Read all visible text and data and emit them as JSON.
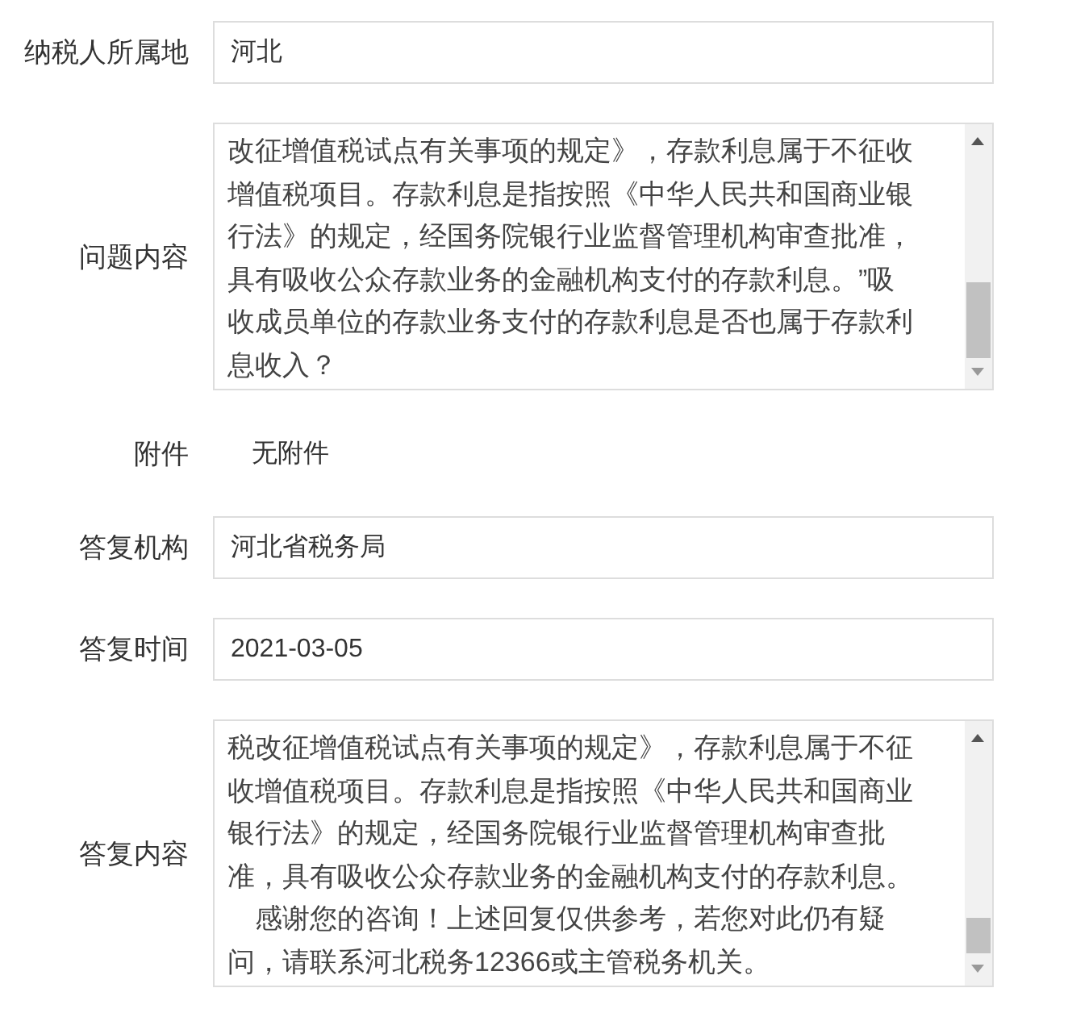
{
  "rows": [
    {
      "kind": "input",
      "label": "纳税人所属地",
      "value": "河北"
    },
    {
      "kind": "textarea",
      "label": "问题内容",
      "lines": [
        "改征增值税试点有关事项的规定》，存款利息属于不征收",
        "增值税项目。存款利息是指按照《中华人民共和国商业银",
        "行法》的规定，经国务院银行业监督管理机构审查批准，",
        "具有吸收公众存款业务的金融机构支付的存款利息。”吸",
        "收成员单位的存款业务支付的存款利息是否也属于存款利",
        "息收入？"
      ]
    },
    {
      "kind": "plain",
      "label": "附件",
      "value": "无附件"
    },
    {
      "kind": "input",
      "label": "答复机构",
      "value": "河北省税务局"
    },
    {
      "kind": "input",
      "label": "答复时间",
      "value": "2021-03-05"
    },
    {
      "kind": "textarea",
      "label": "答复内容",
      "lines": [
        "税改征增值税试点有关事项的规定》，存款利息属于不征",
        "收增值税项目。存款利息是指按照《中华人民共和国商业",
        "银行法》的规定，经国务院银行业监督管理机构审查批",
        "准，具有吸收公众存款业务的金融机构支付的存款利息。",
        "　感谢您的咨询！上述回复仅供参考，若您对此仍有疑",
        "问，请联系河北税务12366或主管税务机关。"
      ]
    }
  ]
}
